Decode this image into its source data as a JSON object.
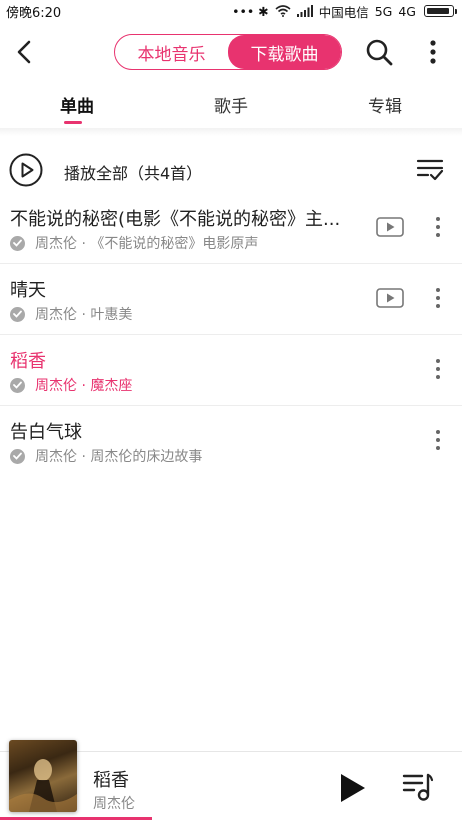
{
  "status_bar": {
    "time": "傍晚6:20",
    "right_text": "••• ✱",
    "carrier": "中国电信",
    "net1": "5G",
    "net2": "4G",
    "battery_level": 0.9
  },
  "header": {
    "segments": [
      "本地音乐",
      "下载歌曲"
    ],
    "active_segment": "下载歌曲"
  },
  "tabs": [
    "单曲",
    "歌手",
    "专辑"
  ],
  "active_tab": "单曲",
  "play_all_label": "播放全部（共4首）",
  "songs": [
    {
      "title": "不能说的秘密(电影《不能说的秘密》主...",
      "subtitle": "周杰伦 · 《不能说的秘密》电影原声",
      "has_mv": true,
      "playing": false
    },
    {
      "title": "晴天",
      "subtitle": "周杰伦 · 叶惠美",
      "has_mv": true,
      "playing": false
    },
    {
      "title": "稻香",
      "subtitle": "周杰伦 · 魔杰座",
      "has_mv": false,
      "playing": true
    },
    {
      "title": "告白气球",
      "subtitle": "周杰伦 · 周杰伦的床边故事",
      "has_mv": false,
      "playing": false
    }
  ],
  "player": {
    "title": "稻香",
    "artist": "周杰伦",
    "progress": 0.33
  },
  "colors": {
    "accent": "#e8336f",
    "text": "#222222",
    "secondary": "#888888"
  }
}
